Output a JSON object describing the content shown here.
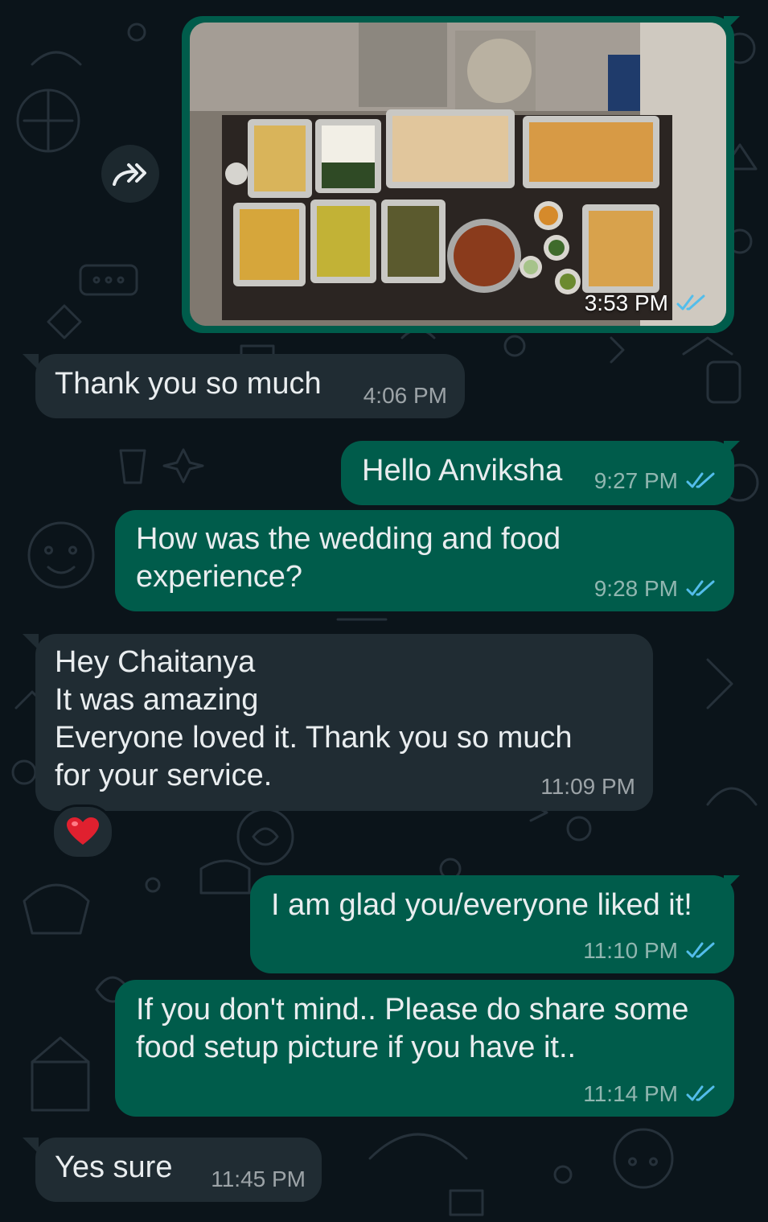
{
  "colors": {
    "background": "#0b141a",
    "outgoing_bubble": "#005c4b",
    "incoming_bubble": "#202c33",
    "text": "#e9edef",
    "read_ticks": "#53bdeb"
  },
  "forward_icon": "forward-icon",
  "photo_message": {
    "time": "3:53 PM",
    "status": "read"
  },
  "messages": [
    {
      "direction": "in",
      "text": "Thank you so much",
      "time": "4:06 PM"
    },
    {
      "direction": "out",
      "text": "Hello Anviksha",
      "time": "9:27 PM",
      "status": "read"
    },
    {
      "direction": "out",
      "text": "How was the wedding and food\nexperience?",
      "time": "9:28 PM",
      "status": "read"
    },
    {
      "direction": "in",
      "text": "Hey Chaitanya\nIt was amazing\nEveryone loved it. Thank you so much\nfor your service.",
      "time": "11:09 PM",
      "reaction": "❤️"
    },
    {
      "direction": "out",
      "text": "I am glad you/everyone liked it!",
      "time": "11:10 PM",
      "status": "read"
    },
    {
      "direction": "out",
      "text": "If you don't mind.. Please do share some\nfood setup picture if you have it..",
      "time": "11:14 PM",
      "status": "read"
    },
    {
      "direction": "in",
      "text": "Yes sure",
      "time": "11:45 PM"
    }
  ]
}
